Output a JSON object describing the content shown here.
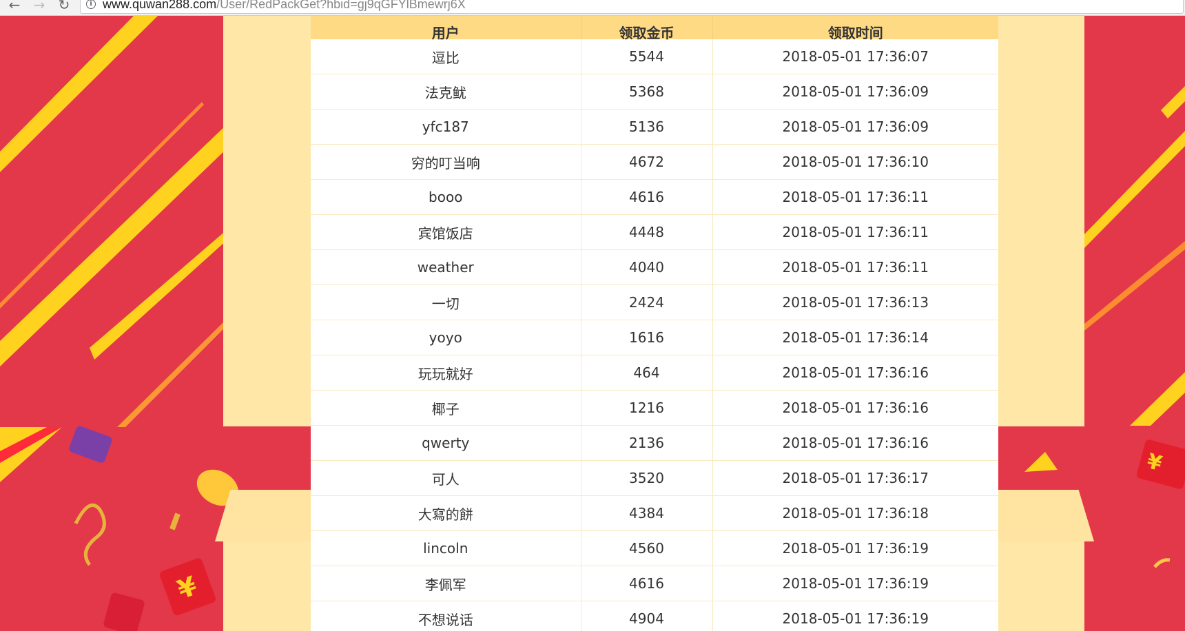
{
  "browser": {
    "url_host": "www.quwan288.com",
    "url_path": "/User/RedPackGet?hbid=gj9qGFYlBmewrj6X",
    "back_icon": "back-arrow-icon",
    "forward_icon": "forward-arrow-icon",
    "reload_icon": "reload-icon",
    "info_icon": "info-icon"
  },
  "colors": {
    "background_red": "#e3374a",
    "stripe_yellow": "#ffd21f",
    "panel_cream": "#ffe7a8",
    "header_gold": "#ffda85"
  },
  "table": {
    "headers": [
      "用户",
      "领取金币",
      "领取时间"
    ],
    "rows": [
      {
        "user": "逗比",
        "coins": "5544",
        "time": "2018-05-01 17:36:07"
      },
      {
        "user": "法克鱿",
        "coins": "5368",
        "time": "2018-05-01 17:36:09"
      },
      {
        "user": "yfc187",
        "coins": "5136",
        "time": "2018-05-01 17:36:09"
      },
      {
        "user": "穷的叮当响",
        "coins": "4672",
        "time": "2018-05-01 17:36:10"
      },
      {
        "user": "booo",
        "coins": "4616",
        "time": "2018-05-01 17:36:11"
      },
      {
        "user": "宾馆饭店",
        "coins": "4448",
        "time": "2018-05-01 17:36:11"
      },
      {
        "user": "weather",
        "coins": "4040",
        "time": "2018-05-01 17:36:11"
      },
      {
        "user": "一切",
        "coins": "2424",
        "time": "2018-05-01 17:36:13"
      },
      {
        "user": "yoyo",
        "coins": "1616",
        "time": "2018-05-01 17:36:14"
      },
      {
        "user": "玩玩就好",
        "coins": "464",
        "time": "2018-05-01 17:36:16"
      },
      {
        "user": "椰子",
        "coins": "1216",
        "time": "2018-05-01 17:36:16"
      },
      {
        "user": "qwerty",
        "coins": "2136",
        "time": "2018-05-01 17:36:16"
      },
      {
        "user": "可人",
        "coins": "3520",
        "time": "2018-05-01 17:36:17"
      },
      {
        "user": "大寫的餅",
        "coins": "4384",
        "time": "2018-05-01 17:36:18"
      },
      {
        "user": "lincoln",
        "coins": "4560",
        "time": "2018-05-01 17:36:19"
      },
      {
        "user": "李佩军",
        "coins": "4616",
        "time": "2018-05-01 17:36:19"
      },
      {
        "user": "不想说话",
        "coins": "4904",
        "time": "2018-05-01 17:36:19"
      }
    ]
  },
  "decoration": {
    "red_envelope_glyph": "¥"
  }
}
